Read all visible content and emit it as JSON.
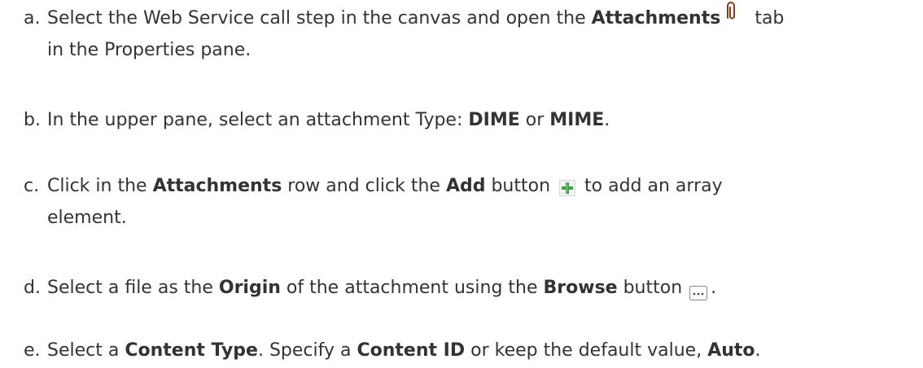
{
  "steps": [
    {
      "marker": "a.",
      "line1_text1": "Select the Web Service call step in the canvas and open the ",
      "line1_bold1": "Attachments",
      "line1_text2": "tab",
      "line2_text1": "in the Properties pane."
    },
    {
      "marker": "b.",
      "text1": "In the upper pane, select an attachment Type: ",
      "bold1": "DIME",
      "text2": " or ",
      "bold2": "MIME",
      "text3": "."
    },
    {
      "marker": "c.",
      "line1_text1": "Click in the ",
      "line1_bold1": "Attachments",
      "line1_text2": " row and click the ",
      "line1_bold2": "Add",
      "line1_text3": " button ",
      "line1_text4": " to add an array",
      "line2_text1": "element."
    },
    {
      "marker": "d.",
      "text1": "Select a file as the ",
      "bold1": "Origin",
      "text2": " of the attachment using the ",
      "bold2": "Browse",
      "text3": " button ",
      "text4": "."
    },
    {
      "marker": "e.",
      "text1": "Select a ",
      "bold1": "Content Type",
      "text2": ". Specify a ",
      "bold2": "Content ID",
      "text3": " or keep the default value, ",
      "bold3": "Auto",
      "text4": "."
    }
  ],
  "icons": {
    "attachments": "paperclip-icon",
    "add": "plus-icon",
    "browse": "browse-icon"
  },
  "colors": {
    "text": "#333333",
    "paperclip": "#8b3a1a",
    "add_plus": "#43a047",
    "browse_border": "#8a8a8a"
  }
}
